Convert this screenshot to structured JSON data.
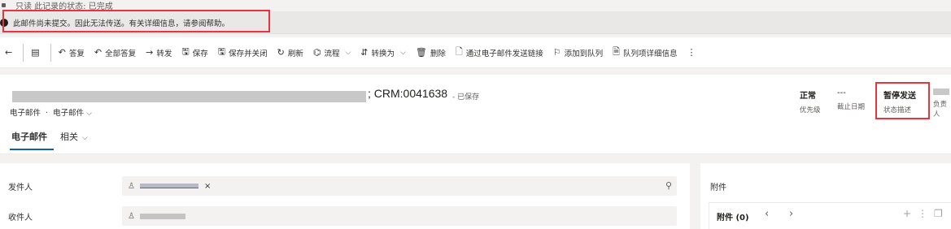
{
  "top_status": "只读 此记录的状态: 已完成",
  "notice": "此邮件尚未提交。因此无法传送。有关详细信息，请参阅帮助。",
  "toolbar": {
    "items": [
      {
        "icon": "arrow-left-icon",
        "glyph": "←",
        "label": ""
      },
      {
        "icon": "form-icon",
        "glyph": "▤",
        "label": ""
      },
      {
        "icon": "reply-icon",
        "glyph": "↶",
        "label": "答复"
      },
      {
        "icon": "reply-all-icon",
        "glyph": "↶",
        "label": "全部答复"
      },
      {
        "icon": "forward-icon",
        "glyph": "→",
        "label": "转发"
      },
      {
        "icon": "save-icon",
        "glyph": "🖫",
        "label": "保存"
      },
      {
        "icon": "save-close-icon",
        "glyph": "🖫",
        "label": "保存并关闭"
      },
      {
        "icon": "refresh-icon",
        "glyph": "↻",
        "label": "刷新"
      },
      {
        "icon": "flow-icon",
        "glyph": "⌬",
        "label": "流程"
      },
      {
        "icon": "convert-icon",
        "glyph": "⇵",
        "label": "转换为"
      },
      {
        "icon": "delete-icon",
        "glyph": "🗑",
        "label": "删除"
      },
      {
        "icon": "email-link-icon",
        "glyph": "🗋",
        "label": "通过电子邮件发送链接"
      },
      {
        "icon": "add-queue-icon",
        "glyph": "⚐",
        "label": "添加到队列"
      },
      {
        "icon": "queue-details-icon",
        "glyph": "🗎",
        "label": "队列项详细信息"
      },
      {
        "icon": "more-icon",
        "glyph": "⋮",
        "label": ""
      }
    ]
  },
  "header": {
    "record_id": "; CRM:0041638",
    "save_state": "- 已保存",
    "entity_type": "电子邮件",
    "form_name": "电子邮件",
    "tabs": [
      "电子邮件",
      "相关"
    ],
    "fields": [
      {
        "value": "正常",
        "label": "优先级"
      },
      {
        "value": "---",
        "label": "截止日期"
      },
      {
        "value": "暂停发送",
        "label": "状态描述"
      },
      {
        "value": "",
        "label": "负责人"
      }
    ]
  },
  "form": {
    "from_label": "发件人",
    "to_label": "收件人"
  },
  "attachments": {
    "section_label": "附件",
    "grid_label": "附件 (0)"
  }
}
